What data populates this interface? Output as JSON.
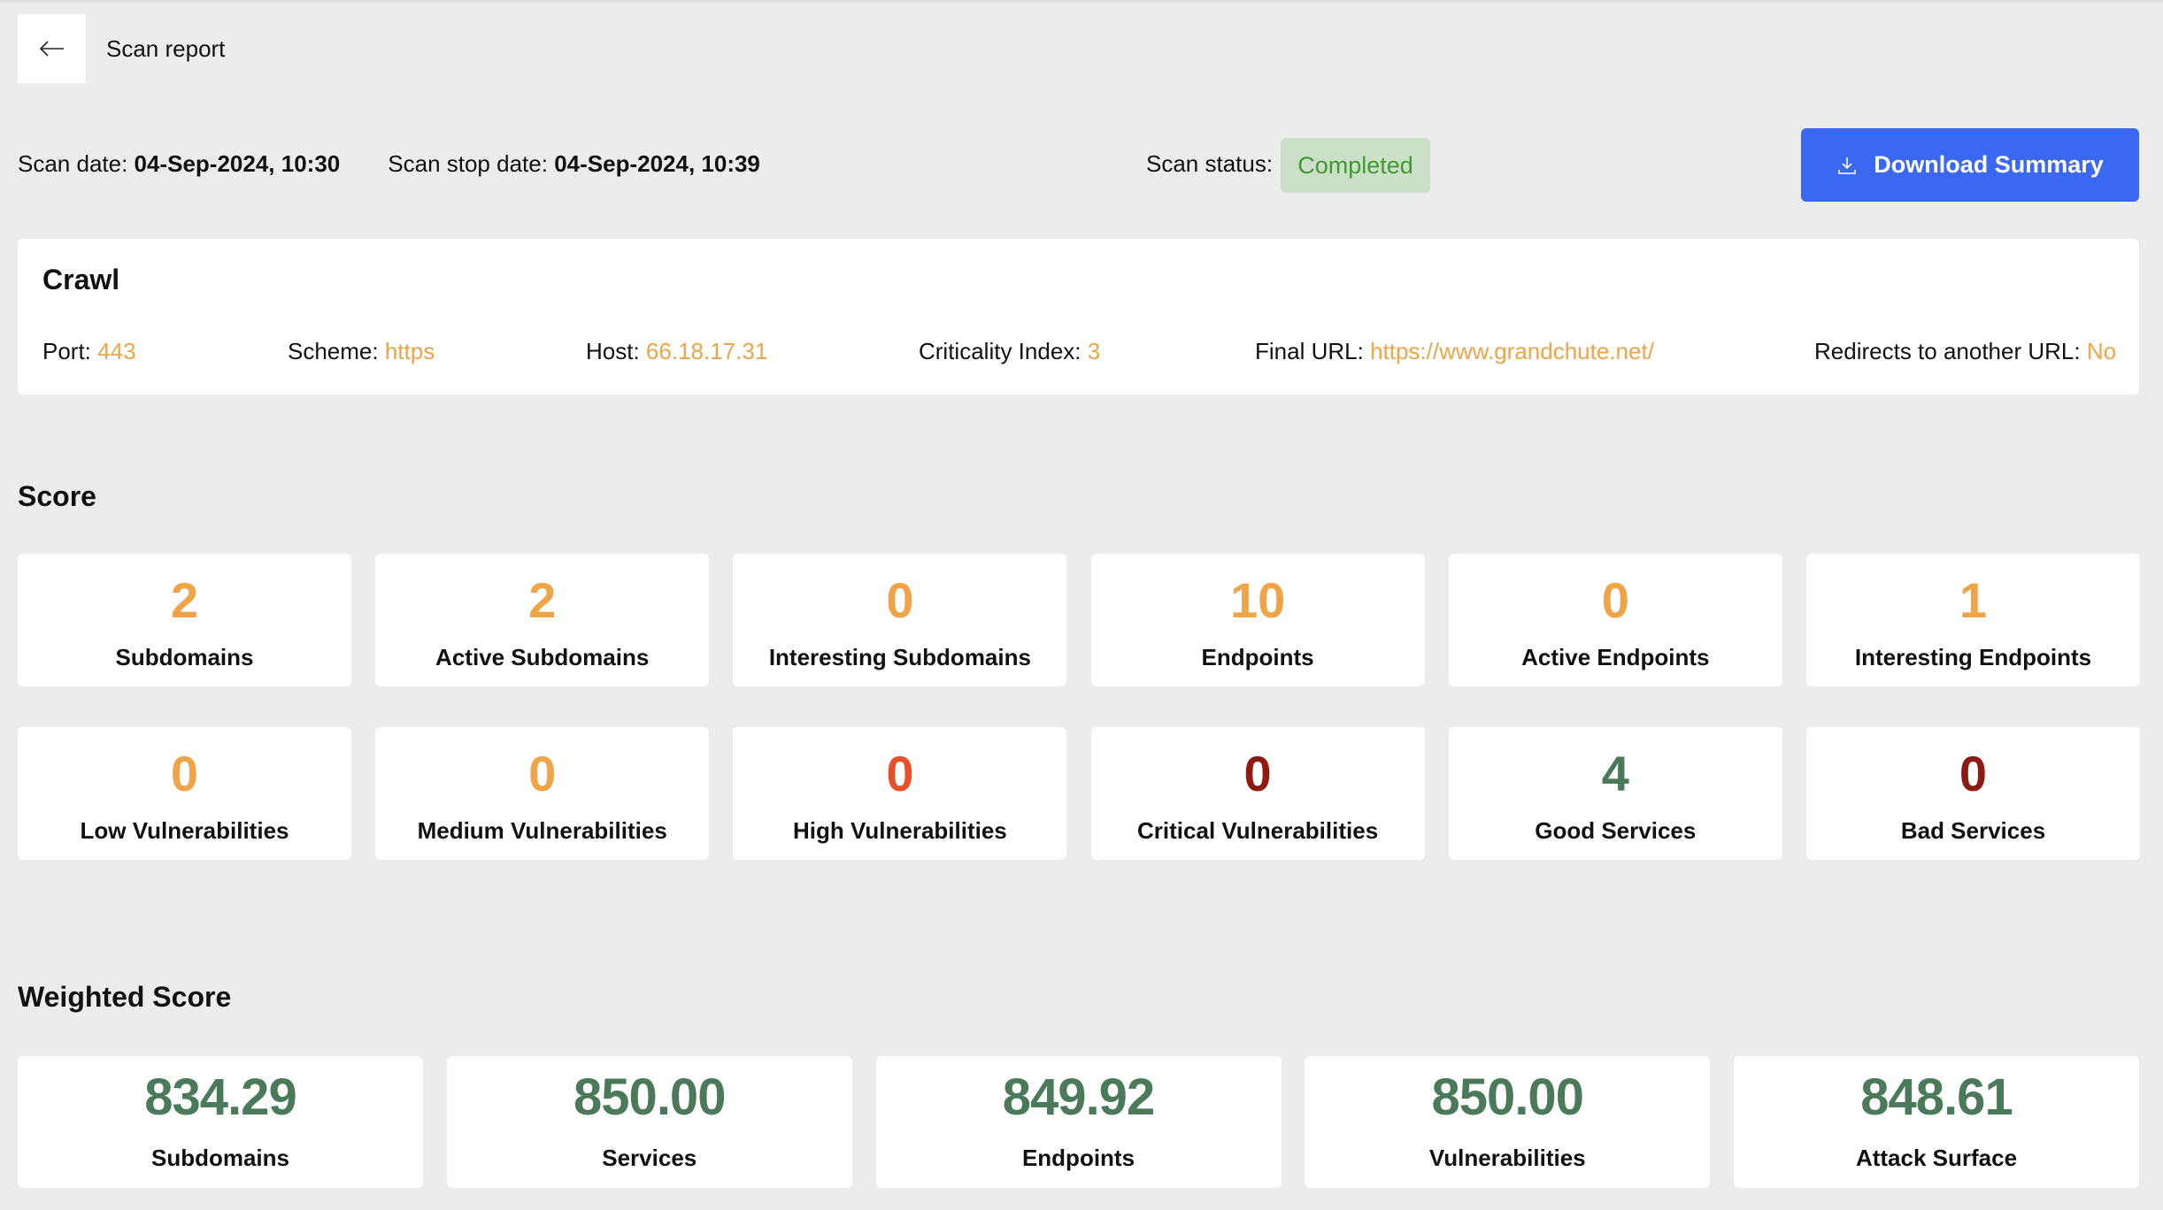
{
  "header": {
    "back_label": "Back",
    "title": "Scan report"
  },
  "meta": {
    "scan_date_label": "Scan date:",
    "scan_date_value": "04-Sep-2024, 10:30",
    "scan_stop_label": "Scan stop date:",
    "scan_stop_value": "04-Sep-2024, 10:39",
    "status_label": "Scan status:",
    "status_value": "Completed",
    "download_label": "Download Summary"
  },
  "crawl": {
    "title": "Crawl",
    "fields": [
      {
        "label": "Port:",
        "value": "443"
      },
      {
        "label": "Scheme:",
        "value": "https"
      },
      {
        "label": "Host:",
        "value": "66.18.17.31"
      },
      {
        "label": "Criticality Index:",
        "value": "3"
      },
      {
        "label": "Final URL:",
        "value": "https://www.grandchute.net/"
      },
      {
        "label": "Redirects to another URL:",
        "value": "No"
      }
    ]
  },
  "score": {
    "title": "Score",
    "cards": [
      {
        "value": "2",
        "label": "Subdomains",
        "color": "#efa447"
      },
      {
        "value": "2",
        "label": "Active Subdomains",
        "color": "#efa447"
      },
      {
        "value": "0",
        "label": "Interesting Subdomains",
        "color": "#efa447"
      },
      {
        "value": "10",
        "label": "Endpoints",
        "color": "#efa447"
      },
      {
        "value": "0",
        "label": "Active Endpoints",
        "color": "#efa447"
      },
      {
        "value": "1",
        "label": "Interesting Endpoints",
        "color": "#efa447"
      },
      {
        "value": "0",
        "label": "Low Vulnerabilities",
        "color": "#efa447"
      },
      {
        "value": "0",
        "label": "Medium Vulnerabilities",
        "color": "#efa447"
      },
      {
        "value": "0",
        "label": "High Vulnerabilities",
        "color": "#e8502a"
      },
      {
        "value": "0",
        "label": "Critical Vulnerabilities",
        "color": "#8e1a12"
      },
      {
        "value": "4",
        "label": "Good Services",
        "color": "#4a7a5a"
      },
      {
        "value": "0",
        "label": "Bad Services",
        "color": "#8e1a12"
      }
    ]
  },
  "weighted": {
    "title": "Weighted Score",
    "color": "#4a7a5a",
    "cards": [
      {
        "value": "834.29",
        "label": "Subdomains"
      },
      {
        "value": "850.00",
        "label": "Services"
      },
      {
        "value": "849.92",
        "label": "Endpoints"
      },
      {
        "value": "850.00",
        "label": "Vulnerabilities"
      },
      {
        "value": "848.61",
        "label": "Attack Surface"
      }
    ]
  }
}
